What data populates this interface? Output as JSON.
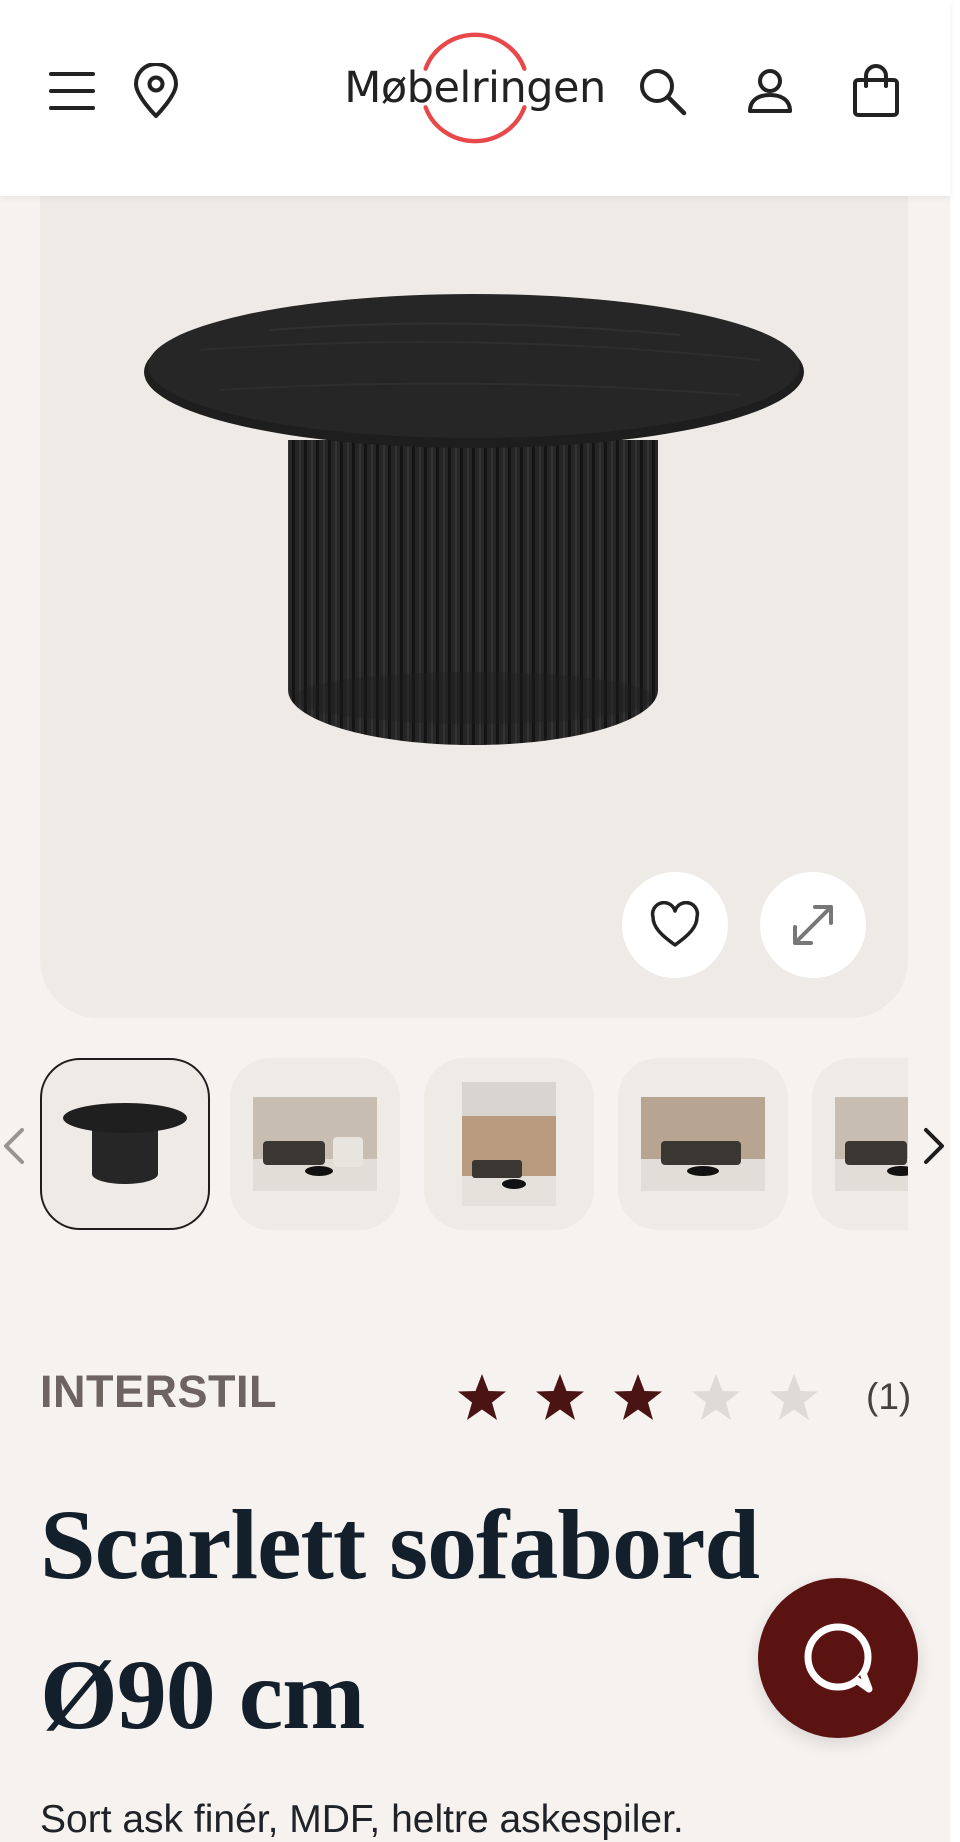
{
  "header": {
    "brand_name": "Møbelringen",
    "menu_icon": "hamburger-menu-icon",
    "store_icon": "map-pin-icon",
    "search_icon": "search-icon",
    "account_icon": "user-icon",
    "cart_icon": "shopping-bag-icon",
    "logo_ring_color": "#e8484a"
  },
  "gallery": {
    "favorite_icon": "heart-icon",
    "expand_icon": "expand-arrows-icon",
    "prev_icon": "chevron-left-icon",
    "next_icon": "chevron-right-icon",
    "thumbnails": [
      {
        "kind": "product",
        "selected": true
      },
      {
        "kind": "room",
        "selected": false
      },
      {
        "kind": "room",
        "selected": false
      },
      {
        "kind": "room",
        "selected": false
      },
      {
        "kind": "room",
        "selected": false
      }
    ]
  },
  "product": {
    "brand": "INTERSTIL",
    "rating": 3,
    "rating_max": 5,
    "review_count": "(1)",
    "title": "Scarlett sofabord Ø90 cm",
    "description": "Sort ask finér, MDF, heltre askespiler."
  },
  "colors": {
    "star_filled": "#4a1414",
    "star_empty": "#dedad6",
    "chat_button": "#5b1312"
  },
  "chat": {
    "icon": "chat-bubble-icon"
  }
}
